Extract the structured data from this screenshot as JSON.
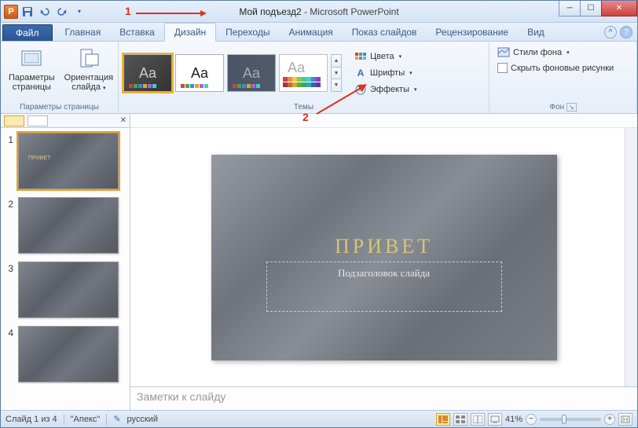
{
  "window": {
    "doc_name": "Мой подъезд2",
    "app_name": "Microsoft PowerPoint"
  },
  "tabs": {
    "file": "Файл",
    "home": "Главная",
    "insert": "Вставка",
    "design": "Дизайн",
    "transitions": "Переходы",
    "animation": "Анимация",
    "slideshow": "Показ слайдов",
    "review": "Рецензирование",
    "view": "Вид"
  },
  "ribbon": {
    "page_setup": {
      "page_params": "Параметры\nстраницы",
      "orientation": "Ориентация\nслайда",
      "group_label": "Параметры страницы"
    },
    "themes": {
      "group_label": "Темы",
      "colors": "Цвета",
      "fonts": "Шрифты",
      "effects": "Эффекты"
    },
    "background": {
      "group_label": "Фон",
      "styles": "Стили фона",
      "hide_bg": "Скрыть фоновые рисунки"
    }
  },
  "slide": {
    "title": "ПРИВЕТ",
    "subtitle": "Подзаголовок слайда",
    "thumb_title": "ПРИВЕТ"
  },
  "notes": {
    "placeholder": "Заметки к слайду"
  },
  "statusbar": {
    "slide_info": "Слайд 1 из 4",
    "theme": "\"Апекс\"",
    "language": "русский",
    "zoom": "41%"
  },
  "annotations": {
    "n1": "1",
    "n2": "2"
  }
}
